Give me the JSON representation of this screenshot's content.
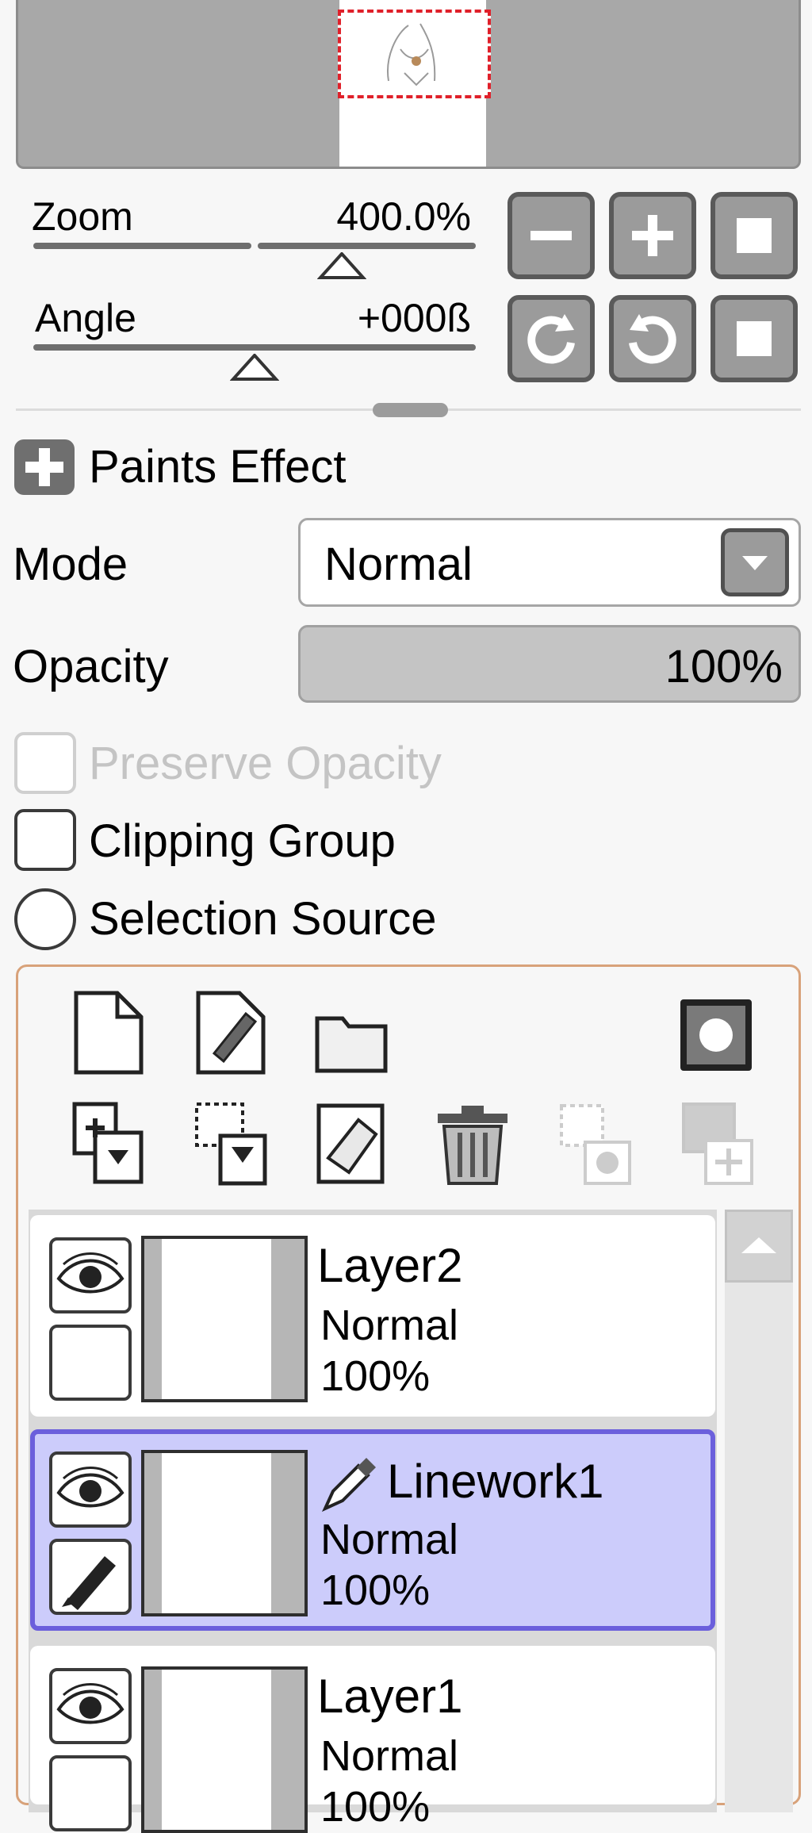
{
  "navigator": {
    "viewport_label": "navigator-viewport"
  },
  "zoom": {
    "label": "Zoom",
    "value": "400.0%"
  },
  "angle": {
    "label": "Angle",
    "value": "+000ß"
  },
  "view_buttons": {
    "zoom_out": "minus-icon",
    "zoom_in": "plus-icon",
    "zoom_reset": "square-icon",
    "rotate_left": "rotate-ccw-icon",
    "rotate_right": "rotate-cw-icon",
    "angle_reset": "square-icon"
  },
  "paints_effect": {
    "label": "Paints Effect"
  },
  "mode": {
    "label": "Mode",
    "value": "Normal"
  },
  "opacity": {
    "label": "Opacity",
    "value": "100%",
    "level": 1.0
  },
  "preserve_opacity": {
    "label": "Preserve Opacity",
    "checked": false,
    "enabled": false
  },
  "clipping_group": {
    "label": "Clipping Group",
    "checked": false
  },
  "selection_source": {
    "label": "Selection Source",
    "checked": false
  },
  "layer_tools_row1": [
    "new-layer-icon",
    "new-linework-layer-icon",
    "new-folder-icon",
    "mask-icon"
  ],
  "layer_tools_row2": [
    "transfer-down-icon",
    "merge-down-icon",
    "clear-layer-icon",
    "delete-layer-icon",
    "merge-visible-icon",
    "merge-all-icon"
  ],
  "layers": [
    {
      "name": "Layer2",
      "mode": "Normal",
      "opacity": "100%",
      "selected": false,
      "linework": false
    },
    {
      "name": "Linework1",
      "mode": "Normal",
      "opacity": "100%",
      "selected": true,
      "linework": true
    },
    {
      "name": "Layer1",
      "mode": "Normal",
      "opacity": "100%",
      "selected": false,
      "linework": false
    }
  ],
  "colors": {
    "selection_accent": "#6b5fdc",
    "selection_bg": "#ccccfb",
    "panel_border": "#d8a27a",
    "viewport_border": "#e0202a"
  }
}
